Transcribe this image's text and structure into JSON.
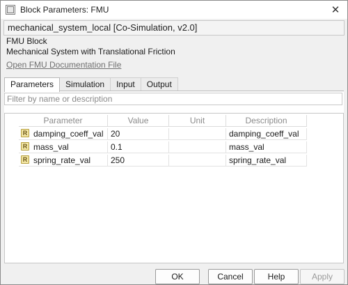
{
  "window": {
    "title": "Block Parameters: FMU"
  },
  "header": {
    "model_info": "mechanical_system_local [Co-Simulation, v2.0]",
    "block_type": "FMU Block",
    "block_description": "Mechanical System with Translational Friction",
    "doc_link": "Open FMU Documentation File"
  },
  "tabs": [
    {
      "label": "Parameters",
      "active": true
    },
    {
      "label": "Simulation",
      "active": false
    },
    {
      "label": "Input",
      "active": false
    },
    {
      "label": "Output",
      "active": false
    }
  ],
  "filter": {
    "placeholder": "Filter by name or description",
    "value": ""
  },
  "table": {
    "columns": [
      "Parameter",
      "Value",
      "Unit",
      "Description"
    ],
    "rows": [
      {
        "icon": "real-parameter-icon",
        "icon_glyph": "R",
        "name": "damping_coeff_val",
        "value": "20",
        "unit": "",
        "description": "damping_coeff_val"
      },
      {
        "icon": "real-parameter-icon",
        "icon_glyph": "R",
        "name": "mass_val",
        "value": "0.1",
        "unit": "",
        "description": "mass_val"
      },
      {
        "icon": "real-parameter-icon",
        "icon_glyph": "R",
        "name": "spring_rate_val",
        "value": "250",
        "unit": "",
        "description": "spring_rate_val"
      }
    ]
  },
  "buttons": {
    "ok": "OK",
    "cancel": "Cancel",
    "help": "Help",
    "apply": "Apply"
  },
  "icons": {
    "app": "simulink-block-icon",
    "close": "close-icon",
    "close_glyph": "✕"
  },
  "colors": {
    "link": "#707070",
    "icon_fill": "#f5e9a8",
    "icon_border": "#b59d3c"
  }
}
